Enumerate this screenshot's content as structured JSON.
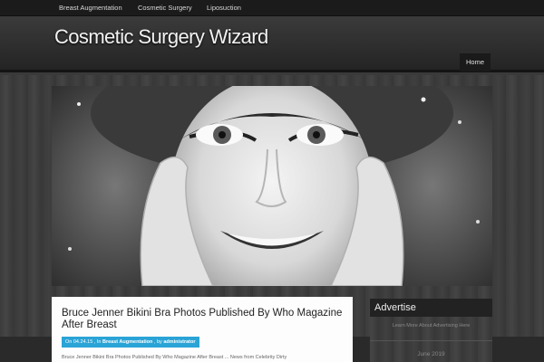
{
  "topnav": {
    "items": [
      "Breast Augmentation",
      "Cosmetic Surgery",
      "Liposuction"
    ]
  },
  "header": {
    "site_title": "Cosmetic Surgery Wizard",
    "nav_home": "Home"
  },
  "post": {
    "title": "Bruce Jenner Bikini Bra Photos Published By Who Magazine After Breast",
    "meta_on": "On 04.24.15 , In",
    "meta_category": "Breast Augmentation",
    "meta_by": ", by",
    "meta_author": "administrator",
    "excerpt": "Bruce Jenner Bikini Bra Photos Published By Who Magazine After Breast ... News from Celebrity Dirty"
  },
  "sidebar": {
    "widget_title": "Advertise",
    "widget_link": "Learn More About Advertising Here",
    "calendar_month": "June 2019"
  },
  "colors": {
    "accent": "#2aa3d6"
  }
}
